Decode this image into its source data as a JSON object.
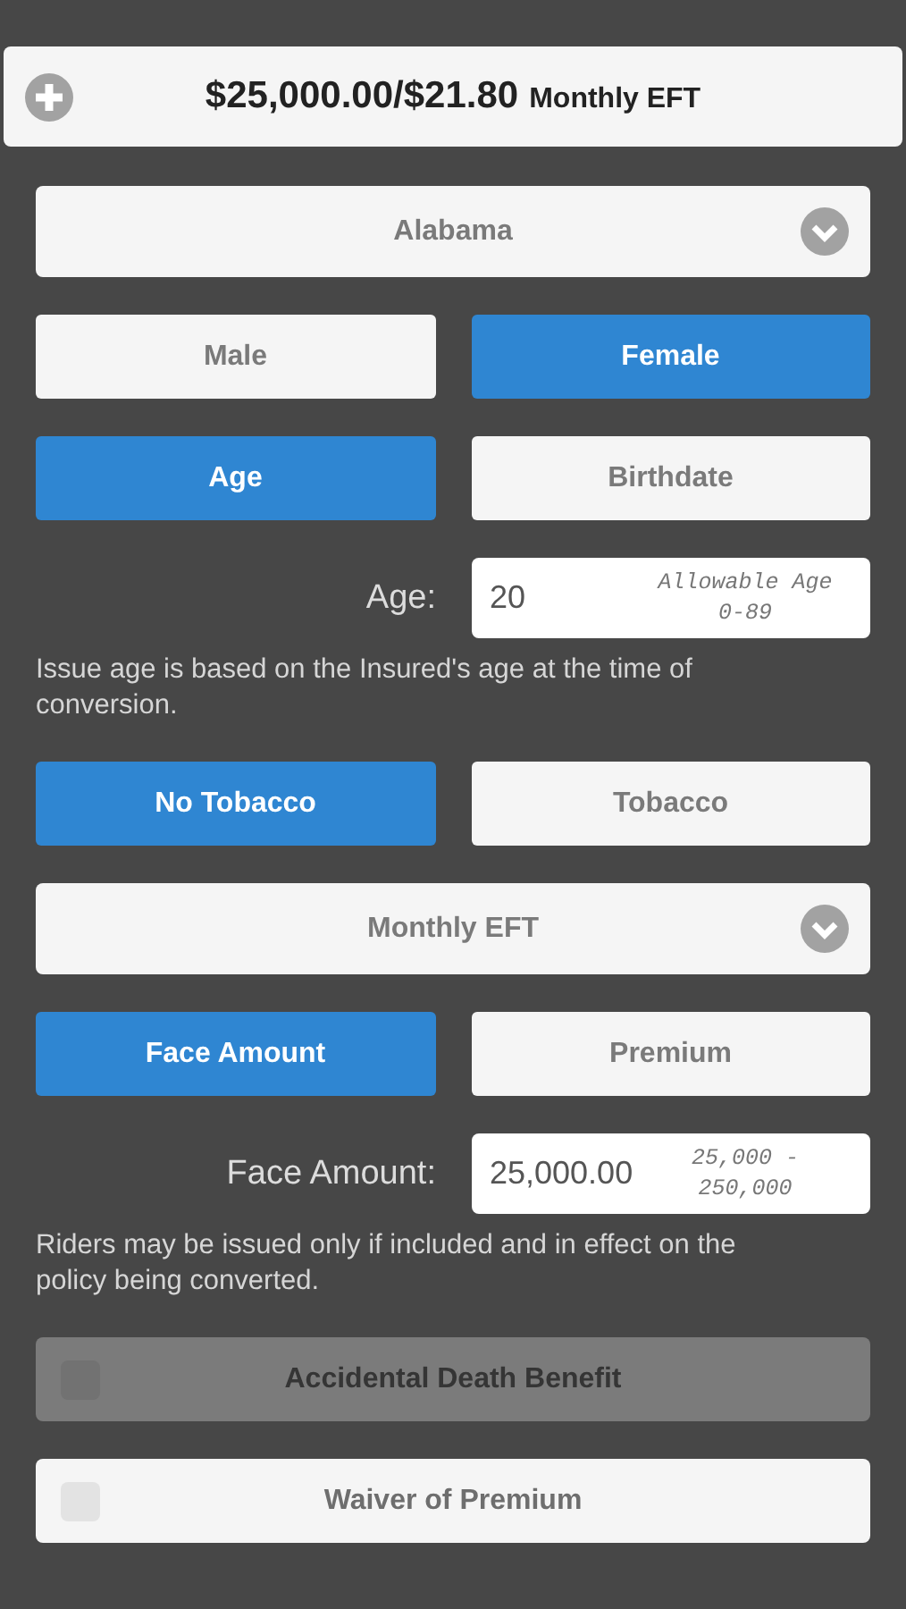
{
  "summary": {
    "amount": "$25,000.00/$21.80",
    "mode": "Monthly EFT"
  },
  "form": [
    {
      "kind": "select",
      "value": "Alabama"
    },
    {
      "kind": "segment",
      "options": [
        {
          "label": "Male",
          "selected": false
        },
        {
          "label": "Female",
          "selected": true
        }
      ]
    },
    {
      "kind": "segment",
      "options": [
        {
          "label": "Age",
          "selected": true
        },
        {
          "label": "Birthdate",
          "selected": false
        }
      ]
    },
    {
      "kind": "field",
      "label": "Age:",
      "value": "20",
      "hint": "Allowable Age 0-89"
    },
    {
      "kind": "note",
      "text": "Issue age is based on the Insured's age at the time of conversion."
    },
    {
      "kind": "segment",
      "options": [
        {
          "label": "No Tobacco",
          "selected": true
        },
        {
          "label": "Tobacco",
          "selected": false
        }
      ]
    },
    {
      "kind": "select",
      "value": "Monthly EFT"
    },
    {
      "kind": "segment",
      "options": [
        {
          "label": "Face Amount",
          "selected": true
        },
        {
          "label": "Premium",
          "selected": false
        }
      ]
    },
    {
      "kind": "field",
      "label": "Face Amount:",
      "value": "25,000.00",
      "hint": "25,000 - 250,000"
    },
    {
      "kind": "note",
      "text": "Riders may be issued only if included and in effect on the policy being converted."
    },
    {
      "kind": "rider",
      "label": "Accidental Death Benefit",
      "checked": false,
      "disabled": true
    },
    {
      "kind": "rider",
      "label": "Waiver of Premium",
      "checked": false,
      "disabled": false
    }
  ]
}
